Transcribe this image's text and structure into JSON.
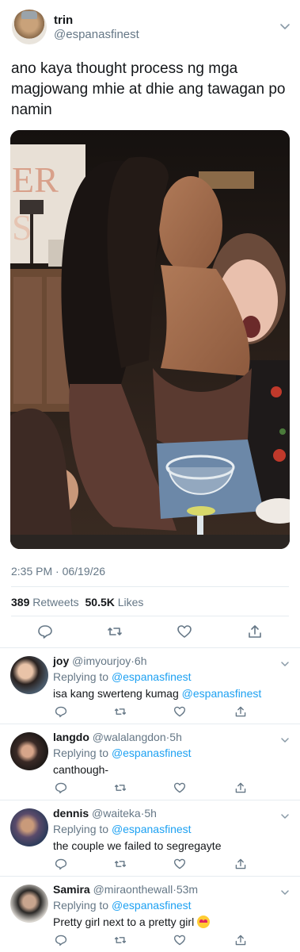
{
  "tweet": {
    "author_name": "trin",
    "author_handle": "@espanasfinest",
    "text": "ano kaya thought process ng mga magjowang mhie at dhie ang tawagan po namin",
    "timestamp": "2:35 PM · 06/19/26",
    "retweets_count": "389",
    "retweets_label": "Retweets",
    "likes_count": "50.5K",
    "likes_label": "Likes"
  },
  "icons": {
    "reply": "speech-bubble-icon",
    "retweet": "retweet-icon",
    "like": "heart-icon",
    "share": "share-icon",
    "more": "chevron-down-icon"
  },
  "colors": {
    "link": "#1da1f2",
    "secondary_text": "#657786",
    "divider": "#e6ecf0"
  },
  "replies": [
    {
      "name": "joy",
      "handle": "@imyourjoy",
      "time": "6h",
      "replying_prefix": "Replying to",
      "replying_to": "@espanasfinest",
      "text": "isa kang swerteng kumag",
      "mention": "@espanasfinest",
      "emoji": ""
    },
    {
      "name": "langdo",
      "handle": "@walalangdon",
      "time": "5h",
      "replying_prefix": "Replying to",
      "replying_to": "@espanasfinest",
      "text": "canthough-",
      "mention": "",
      "emoji": ""
    },
    {
      "name": "dennis",
      "handle": "@waiteka",
      "time": "5h",
      "replying_prefix": "Replying to",
      "replying_to": "@espanasfinest",
      "text": "the couple we failed to segregayte",
      "mention": "",
      "emoji": ""
    },
    {
      "name": "Samira",
      "handle": "@miraonthewall",
      "time": "53m",
      "replying_prefix": "Replying to",
      "replying_to": "@espanasfinest",
      "text": "Pretty girl next to a pretty girl",
      "mention": "",
      "emoji": "heart-eyes-emoji"
    }
  ]
}
